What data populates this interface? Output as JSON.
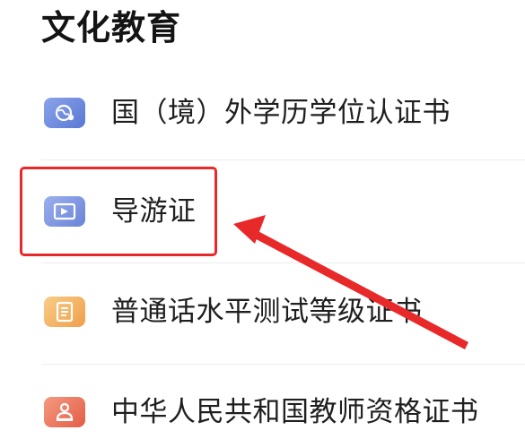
{
  "section": {
    "title": "文化教育"
  },
  "items": [
    {
      "label": "国（境）外学历学位认证书",
      "icon": "globe-certificate-icon",
      "color_from": "#7f9ce8",
      "color_to": "#5a78d4"
    },
    {
      "label": "导游证",
      "icon": "guide-card-icon",
      "color_from": "#8fa6ec",
      "color_to": "#6a83d6"
    },
    {
      "label": "普通话水平测试等级证书",
      "icon": "document-certificate-icon",
      "color_from": "#f7c27a",
      "color_to": "#ef9f49"
    },
    {
      "label": "中华人民共和国教师资格证书",
      "icon": "teacher-certificate-icon",
      "color_from": "#f28a6e",
      "color_to": "#e25d45"
    }
  ],
  "annotation": {
    "highlight_color": "#e8292a"
  }
}
